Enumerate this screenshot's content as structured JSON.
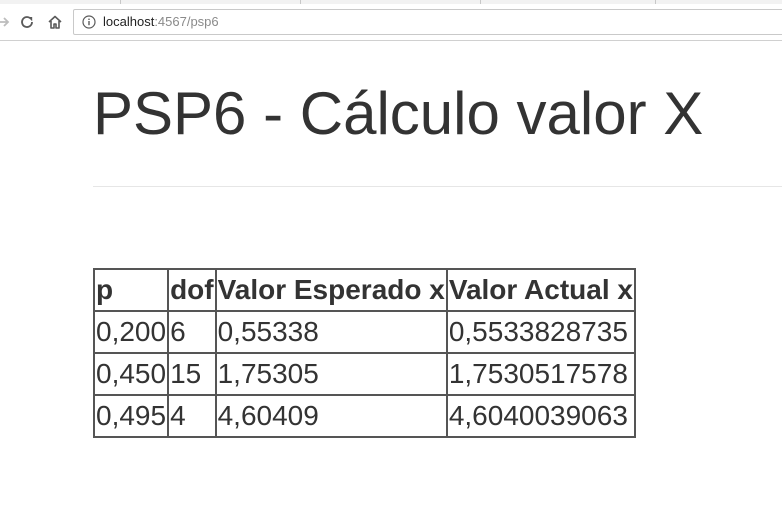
{
  "browser": {
    "url_host": "localhost",
    "url_rest": ":4567/psp6"
  },
  "page": {
    "title": "PSP6 - Cálculo valor X"
  },
  "table": {
    "headers": [
      "p",
      "dof",
      "Valor Esperado x",
      "Valor Actual x"
    ],
    "rows": [
      [
        "0,200",
        "6",
        "0,55338",
        "0,5533828735"
      ],
      [
        "0,450",
        "15",
        "1,75305",
        "1,7530517578"
      ],
      [
        "0,495",
        "4",
        "4,60409",
        "4,6040039063"
      ]
    ]
  }
}
